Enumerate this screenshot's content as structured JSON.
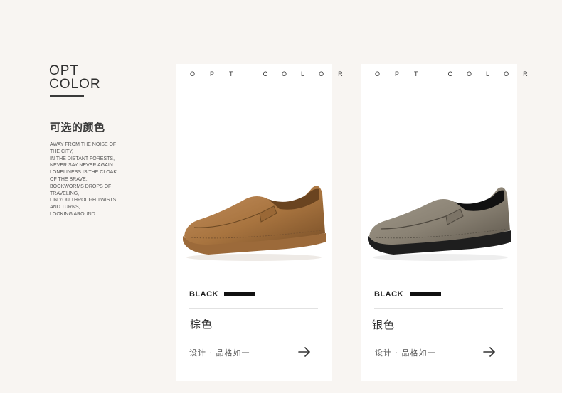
{
  "sidebar": {
    "title_line1": "OPT",
    "title_line2": "COLOR",
    "subtitle": "可选的颜色",
    "poem": [
      "AWAY FROM THE NOISE OF",
      "THE CITY,",
      "IN THE DISTANT FORESTS,",
      "NEVER SAY NEVER AGAIN.",
      "LONELINESS IS THE CLOAK",
      "OF THE BRAVE,",
      "BOOKWORMS DROPS OF",
      "TRAVELING,",
      "LIN YOU THROUGH TWISTS",
      "AND TURNS,",
      "LOOKING AROUND"
    ]
  },
  "cards": [
    {
      "header_letters": [
        "O",
        "P",
        "T",
        "C",
        "O",
        "L",
        "O",
        "R"
      ],
      "color_label": "BLACK",
      "color_cn": "棕色",
      "design_text": "设计 · 品格如一",
      "shoe_icon": "brown-loafer-image",
      "shoe_colors": {
        "upper": "#a8743f",
        "sole": "#9c6a3a",
        "shade": "#7a5028"
      }
    },
    {
      "header_letters": [
        "O",
        "P",
        "T",
        "C",
        "O",
        "L",
        "O",
        "R"
      ],
      "color_label": "BLACK",
      "color_cn": "银色",
      "design_text": "设计 · 品格如一",
      "shoe_icon": "grey-loafer-image",
      "shoe_colors": {
        "upper": "#8a8274",
        "sole": "#1e1e1e",
        "shade": "#5e574c"
      }
    }
  ]
}
